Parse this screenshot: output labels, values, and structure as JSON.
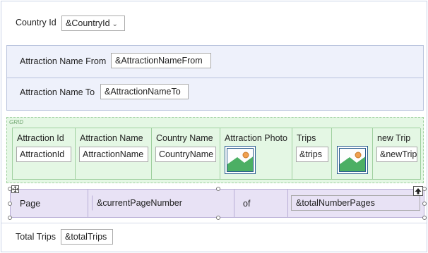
{
  "country": {
    "label": "Country Id",
    "select_value": "&CountryId",
    "select_arrow": "chevron-down-icon"
  },
  "attraction_filter": {
    "from_label": "Attraction Name From",
    "from_value": "&AttractionNameFrom",
    "to_label": "Attraction Name To",
    "to_value": "&AttractionNameTo"
  },
  "grid": {
    "tag": "GRID",
    "columns": [
      {
        "header": "Attraction Id",
        "cell": "AttractionId",
        "kind": "text"
      },
      {
        "header": "Attraction Name",
        "cell": "AttractionName",
        "kind": "text"
      },
      {
        "header": "Country Name",
        "cell": "CountryName",
        "kind": "text"
      },
      {
        "header": "Attraction Photo",
        "cell": "",
        "kind": "image"
      },
      {
        "header": "Trips",
        "cell": "&trips",
        "kind": "text"
      },
      {
        "header": "",
        "cell": "",
        "kind": "image"
      },
      {
        "header": "new Trip",
        "cell": "&newTrip",
        "kind": "text"
      }
    ]
  },
  "pager": {
    "page_label": "Page",
    "current_page": "&currentPageNumber",
    "of_label": "of",
    "total_pages": "&totalNumberPages"
  },
  "total_trips": {
    "label": "Total Trips",
    "value": "&totalTrips"
  },
  "colors": {
    "blue_group": "#eef1fb",
    "grid_green": "#e4f7e4",
    "pager_purple": "#e8e2f5",
    "image_border": "#2b5e8f",
    "image_sun": "#f0a050",
    "image_hill": "#4caf64"
  }
}
